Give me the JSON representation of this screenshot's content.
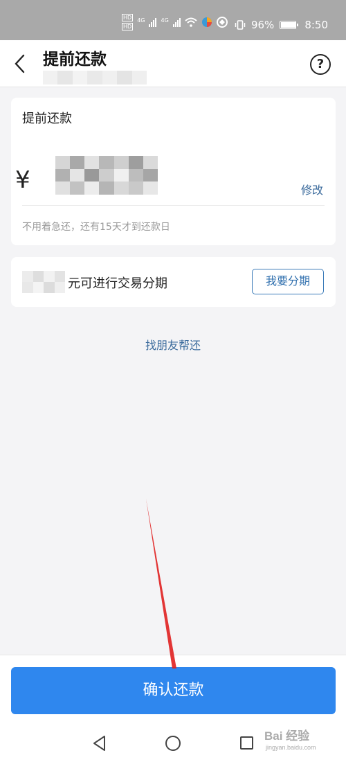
{
  "status_bar": {
    "hd": "HD",
    "network1": "4G",
    "network2": "4G",
    "battery": "96%",
    "time": "8:50"
  },
  "header": {
    "title": "提前还款",
    "help_symbol": "?"
  },
  "repay_card": {
    "title": "提前还款",
    "currency": "¥",
    "modify_label": "修改",
    "hint": "不用着急还，还有15天才到还款日"
  },
  "installment_card": {
    "text": "元可进行交易分期",
    "button_label": "我要分期"
  },
  "friend_link": "找朋友帮还",
  "confirm_button": "确认还款",
  "watermark": {
    "main": "Bai 经验",
    "sub": "jingyan.baidu.com"
  },
  "colors": {
    "primary_button": "#2f87ee",
    "link": "#3a6a9c",
    "annotation_arrow": "#e02020"
  }
}
